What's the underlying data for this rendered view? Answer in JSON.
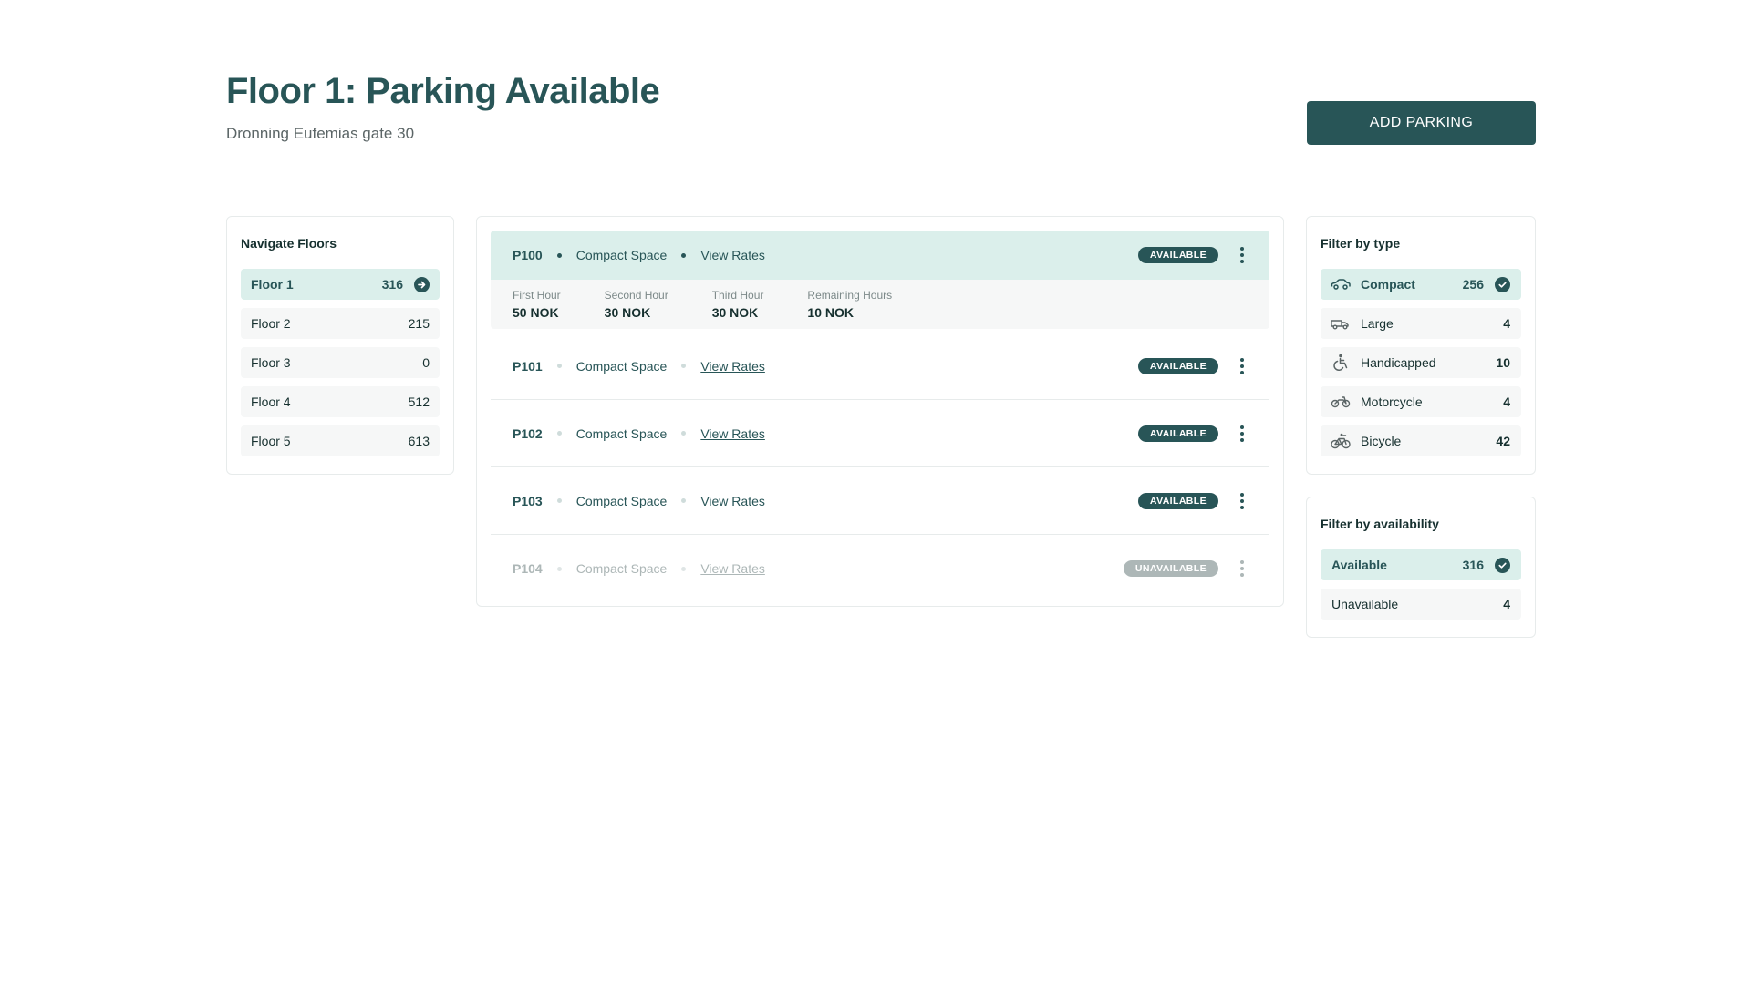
{
  "header": {
    "title": "Floor 1: Parking Available",
    "subtitle": "Dronning Eufemias gate 30",
    "add_button": "ADD PARKING"
  },
  "floors": {
    "title": "Navigate Floors",
    "items": [
      {
        "label": "Floor 1",
        "count": "316",
        "active": true
      },
      {
        "label": "Floor 2",
        "count": "215"
      },
      {
        "label": "Floor 3",
        "count": "0"
      },
      {
        "label": "Floor 4",
        "count": "512"
      },
      {
        "label": "Floor 5",
        "count": "613"
      }
    ]
  },
  "spaces": [
    {
      "code": "P100",
      "type": "Compact Space",
      "rates_link": "View Rates",
      "status": "AVAILABLE",
      "expanded": true
    },
    {
      "code": "P101",
      "type": "Compact Space",
      "rates_link": "View Rates",
      "status": "AVAILABLE"
    },
    {
      "code": "P102",
      "type": "Compact Space",
      "rates_link": "View Rates",
      "status": "AVAILABLE"
    },
    {
      "code": "P103",
      "type": "Compact Space",
      "rates_link": "View Rates",
      "status": "AVAILABLE"
    },
    {
      "code": "P104",
      "type": "Compact Space",
      "rates_link": "View Rates",
      "status": "UNAVAILABLE",
      "disabled": true
    }
  ],
  "rates": [
    {
      "label": "First Hour",
      "value": "50 NOK"
    },
    {
      "label": "Second Hour",
      "value": "30 NOK"
    },
    {
      "label": "Third Hour",
      "value": "30 NOK"
    },
    {
      "label": "Remaining Hours",
      "value": "10 NOK"
    }
  ],
  "type_filter": {
    "title": "Filter by type",
    "items": [
      {
        "label": "Compact",
        "count": "256",
        "icon": "car-icon",
        "active": true
      },
      {
        "label": "Large",
        "count": "4",
        "icon": "truck-icon"
      },
      {
        "label": "Handicapped",
        "count": "10",
        "icon": "wheelchair-icon"
      },
      {
        "label": "Motorcycle",
        "count": "4",
        "icon": "motorcycle-icon"
      },
      {
        "label": "Bicycle",
        "count": "42",
        "icon": "bicycle-icon"
      }
    ]
  },
  "availability_filter": {
    "title": "Filter by availability",
    "items": [
      {
        "label": "Available",
        "count": "316",
        "active": true
      },
      {
        "label": "Unavailable",
        "count": "4"
      }
    ]
  },
  "colors": {
    "primary": "#285557",
    "active_bg": "#dbefeb",
    "item_bg": "#f6f7f7",
    "disabled": "#adb7b7"
  }
}
